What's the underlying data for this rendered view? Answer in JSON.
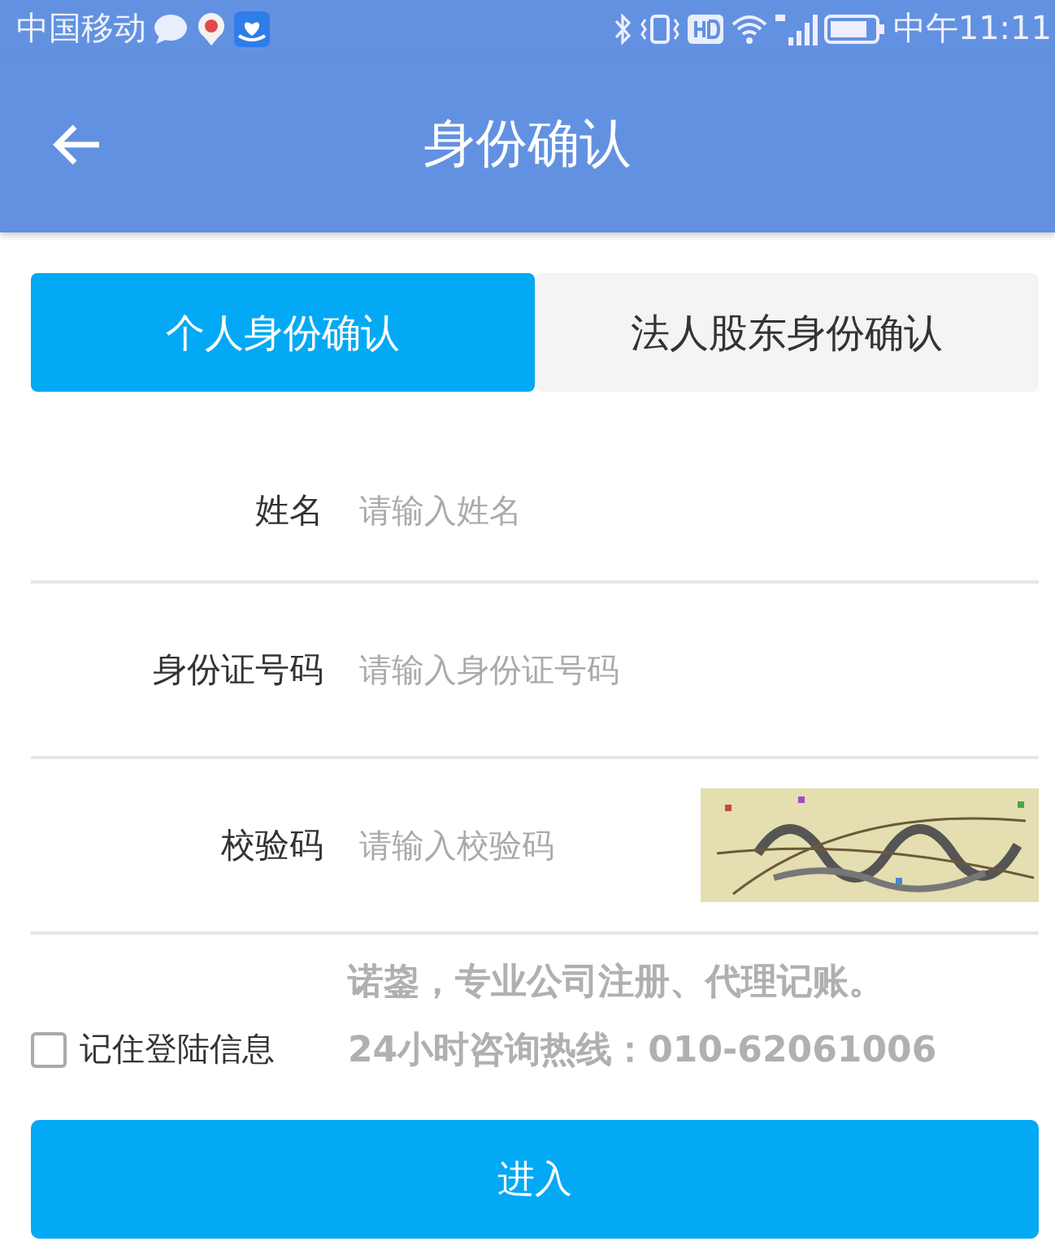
{
  "status_bar": {
    "carrier": "中国移动",
    "time": "中午11:11"
  },
  "header": {
    "title": "身份确认"
  },
  "tabs": [
    {
      "label": "个人身份确认",
      "selected": true
    },
    {
      "label": "法人股东身份确认",
      "selected": false
    }
  ],
  "fields": [
    {
      "label": "姓名",
      "placeholder": "请输入姓名",
      "kind": "text"
    },
    {
      "label": "身份证号码",
      "placeholder": "请输入身份证号码",
      "kind": "text"
    },
    {
      "label": "校验码",
      "placeholder": "请输入校验码",
      "kind": "captcha"
    }
  ],
  "remember": {
    "label": "记住登陆信息",
    "checked": false
  },
  "ad": [
    "诺鋆，专业公司注册、代理记账。",
    "24小时咨询热线：010-62061006"
  ],
  "submit": "进入"
}
